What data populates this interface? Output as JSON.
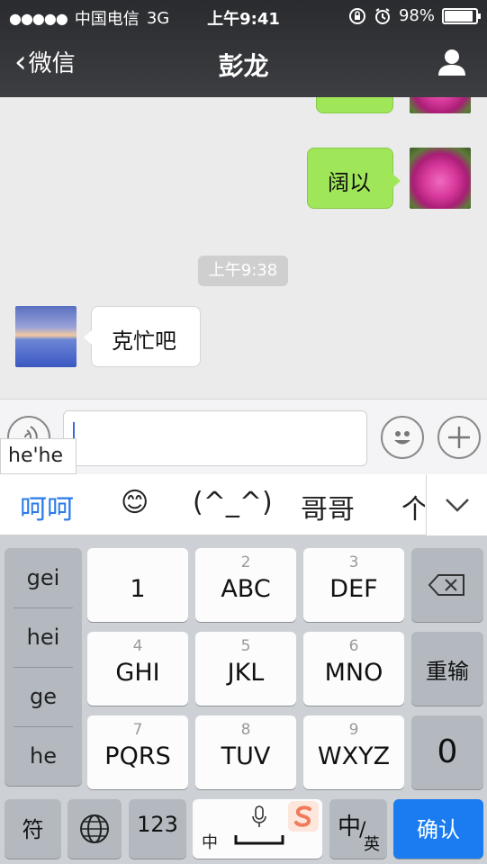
{
  "status_bar": {
    "signal": "●●●●●",
    "carrier": "中国电信",
    "network": "3G",
    "time": "上午9:41",
    "battery": "98%",
    "battery_level": 0.98
  },
  "nav": {
    "back_label": "微信",
    "title": "彭龙"
  },
  "messages": {
    "sent_text": "阔以",
    "timestamp": "上午9:38",
    "received_text": "克忙吧"
  },
  "input": {
    "pinyin_preview": "he'he",
    "value": ""
  },
  "candidates": [
    "呵呵",
    "😊",
    "(^_^)",
    "哥哥",
    "个"
  ],
  "keyboard": {
    "pinyin_options": [
      "gei",
      "hei",
      "ge",
      "he"
    ],
    "keys": [
      {
        "sub": "",
        "main": "1"
      },
      {
        "sub": "2",
        "main": "ABC"
      },
      {
        "sub": "3",
        "main": "DEF"
      },
      {
        "sub": "4",
        "main": "GHI"
      },
      {
        "sub": "5",
        "main": "JKL"
      },
      {
        "sub": "6",
        "main": "MNO"
      },
      {
        "sub": "7",
        "main": "PQRS"
      },
      {
        "sub": "8",
        "main": "TUV"
      },
      {
        "sub": "9",
        "main": "WXYZ"
      }
    ],
    "reenter": "重输",
    "zero": "0",
    "symbol": "符",
    "numbers": "123",
    "space_label": "中",
    "lang_main": "中",
    "lang_sub": "英",
    "confirm": "确认"
  },
  "colors": {
    "sent_bubble": "#9fe658",
    "accent": "#1a7cf0",
    "candidate_selected": "#2a7be8"
  }
}
